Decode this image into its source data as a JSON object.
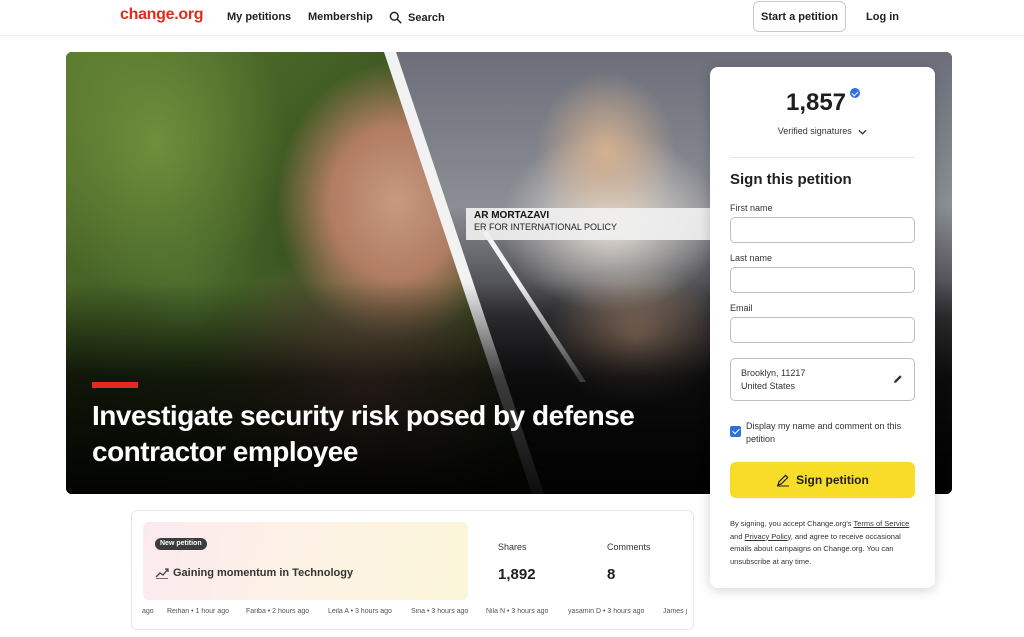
{
  "nav": {
    "logo": "change.org",
    "my_petitions": "My petitions",
    "membership": "Membership",
    "search": "Search",
    "start_petition": "Start a petition",
    "login": "Log in"
  },
  "hero": {
    "title": "Investigate security risk posed by defense contractor employee",
    "caption_name": "AR MORTAZAVI",
    "caption_role": "ER FOR INTERNATIONAL POLICY"
  },
  "sign": {
    "count": "1,857",
    "verified_label": "Verified signatures",
    "heading": "Sign this petition",
    "first_name_label": "First name",
    "last_name_label": "Last name",
    "email_label": "Email",
    "location_line1": "Brooklyn, 11217",
    "location_line2": "United States",
    "display_name_checked": true,
    "display_name_text": "Display my name and comment on this petition",
    "button": "Sign petition",
    "legal_prefix": "By signing, you accept Change.org's",
    "terms": "Terms of Service",
    "legal_and": "and",
    "privacy": "Privacy Policy",
    "legal_suffix": ", and agree to receive occasional emails about campaigns on Change.org. You can unsubscribe at any time."
  },
  "stats": {
    "badge": "New petition",
    "momentum": "Gaining momentum in Technology",
    "shares_label": "Shares",
    "shares_value": "1,892",
    "comments_label": "Comments",
    "comments_value": "8"
  },
  "recent_signers": [
    "ago",
    "Reihan • 1 hour ago",
    "Fariba • 2 hours ago",
    "Leila A • 3 hours ago",
    "Sina • 3 hours ago",
    "Nila N • 3 hours ago",
    "yasamin D • 3 hours ago",
    "James j"
  ],
  "colors": {
    "brand": "#e32a1d",
    "sign_button": "#f7dc28",
    "checkbox": "#2f6fe0"
  },
  "icons": {
    "search": "search-icon",
    "verified": "verified-check-icon",
    "chevron": "chevron-down-icon",
    "edit": "pencil-icon",
    "sign": "pen-icon",
    "trend": "trending-up-icon"
  }
}
